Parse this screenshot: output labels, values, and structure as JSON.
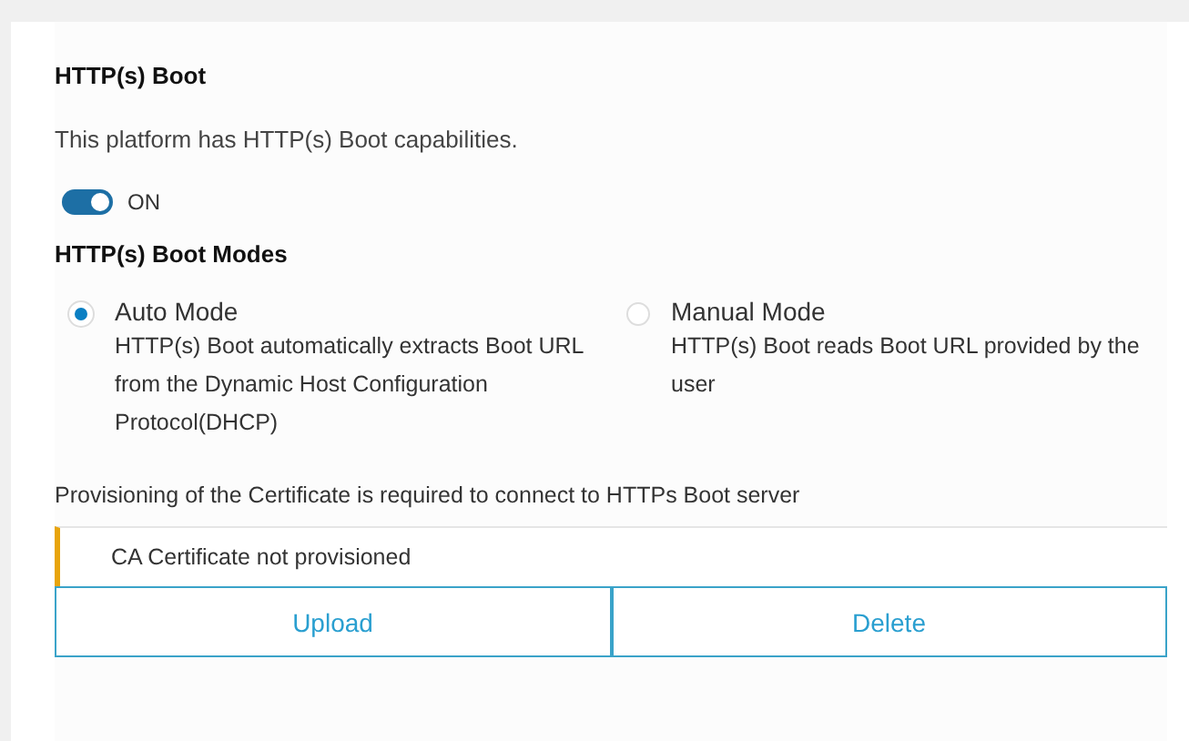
{
  "title": "HTTP(s) Boot",
  "description": "This platform has HTTP(s) Boot capabilities.",
  "toggle": {
    "label": "ON",
    "on": true
  },
  "modes_title": "HTTP(s) Boot Modes",
  "modes": [
    {
      "label": "Auto Mode",
      "description": "HTTP(s) Boot automatically extracts Boot URL from the Dynamic Host Configuration Protocol(DHCP)",
      "selected": true
    },
    {
      "label": "Manual Mode",
      "description": "HTTP(s) Boot reads Boot URL provided by the user",
      "selected": false
    }
  ],
  "certificate_note": "Provisioning of the Certificate is required to connect to HTTPs Boot server",
  "certificate_status": "CA Certificate not provisioned",
  "buttons": [
    "Upload",
    "Delete"
  ]
}
